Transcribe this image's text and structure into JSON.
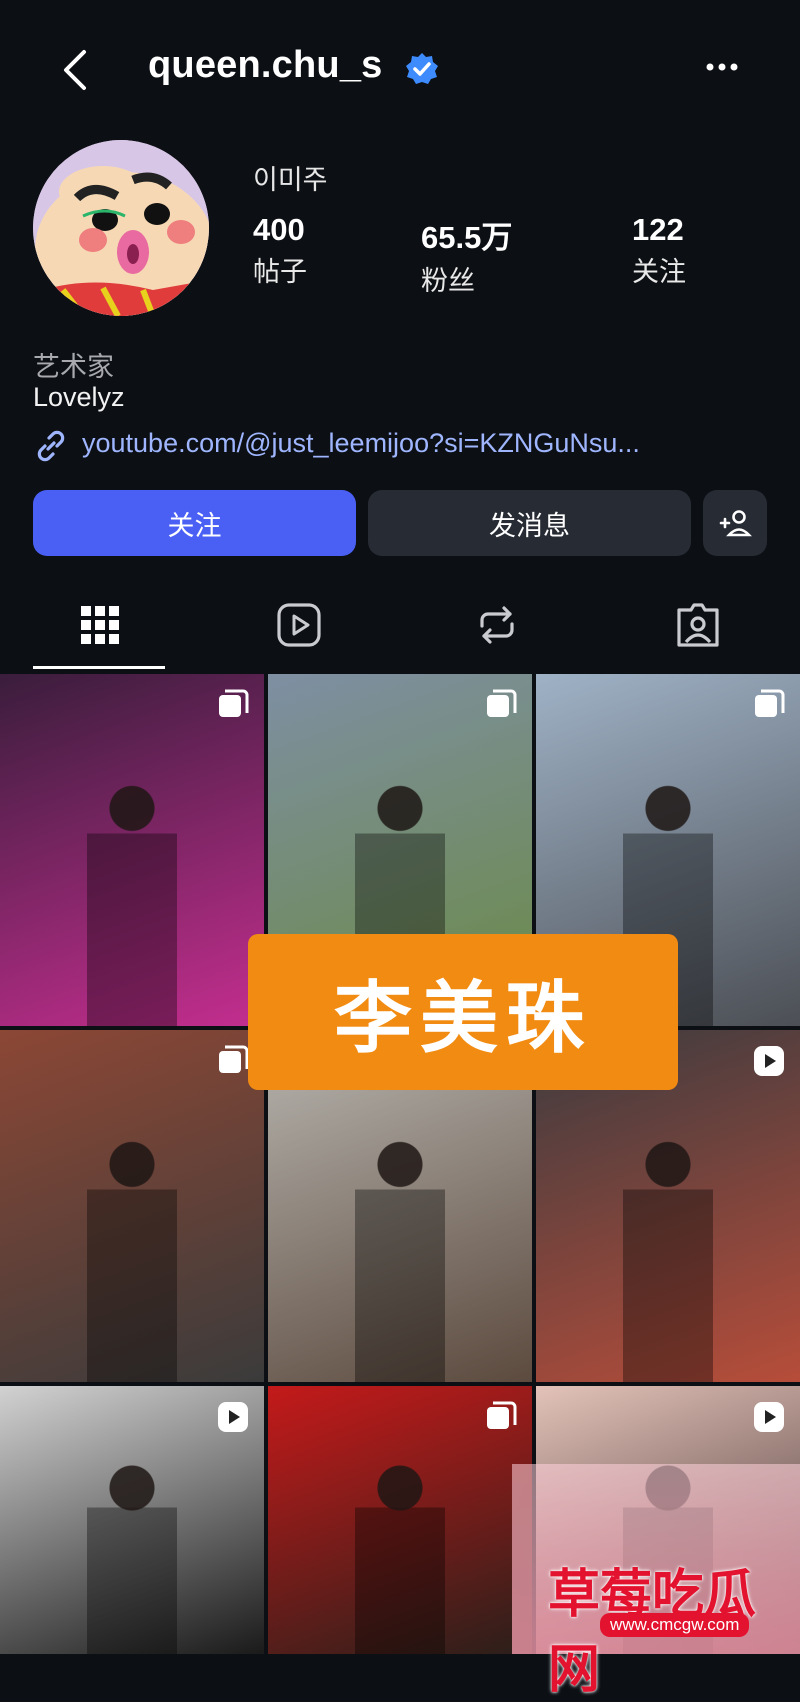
{
  "header": {
    "username": "queen.chu_s"
  },
  "profile": {
    "display_name": "이미주",
    "stats": [
      {
        "value": "400",
        "label": "帖子"
      },
      {
        "value": "65.5万",
        "label": "粉丝"
      },
      {
        "value": "122",
        "label": "关注"
      }
    ],
    "category": "艺术家",
    "bio": "Lovelyz",
    "link": "youtube.com/@just_leemijoo?si=KZNGuNsu..."
  },
  "actions": {
    "follow": "关注",
    "message": "发消息"
  },
  "tabs": [
    {
      "icon": "grid-icon",
      "active": true
    },
    {
      "icon": "reels-icon",
      "active": false
    },
    {
      "icon": "reposts-icon",
      "active": false
    },
    {
      "icon": "tagged-icon",
      "active": false
    }
  ],
  "grid": [
    {
      "badge": "carousel-icon",
      "colors": [
        "#3a1d3c",
        "#c42e8f"
      ]
    },
    {
      "badge": "carousel-icon",
      "colors": [
        "#7e8fa3",
        "#6a8a45"
      ]
    },
    {
      "badge": "carousel-icon",
      "colors": [
        "#9fb2c6",
        "#4c4f55"
      ]
    },
    {
      "badge": "carousel-icon",
      "colors": [
        "#8c4735",
        "#3b3b3b"
      ]
    },
    {
      "badge": "",
      "colors": [
        "#b8b6b0",
        "#5c4a3e"
      ]
    },
    {
      "badge": "reels-icon",
      "colors": [
        "#3c3b3f",
        "#b74d3a"
      ]
    },
    {
      "badge": "reels-icon",
      "colors": [
        "#d2d2d2",
        "#1a1a1a"
      ]
    },
    {
      "badge": "carousel-icon",
      "colors": [
        "#c41a1a",
        "#2a1f1a"
      ]
    },
    {
      "badge": "reels-icon",
      "colors": [
        "#e3c3b9",
        "#3d2a2a"
      ]
    }
  ],
  "overlay": {
    "banner": "李美珠",
    "watermark": "草莓吃瓜网",
    "watermark_url": "www.cmcgw.com"
  },
  "colors": {
    "background": "#0c0f14",
    "follow_button": "#4a60f5",
    "secondary_button": "#272b34",
    "link": "#9fb6ff",
    "verified": "#3d8bfd"
  }
}
